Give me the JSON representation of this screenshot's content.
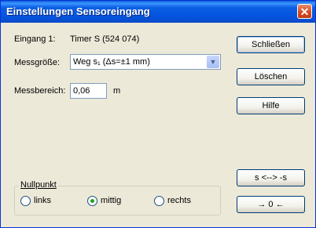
{
  "window": {
    "title": "Einstellungen Sensoreingang",
    "close_glyph": "✕"
  },
  "eingang": {
    "label": "Eingang 1:",
    "value": "Timer S (524 074)"
  },
  "messgroesse": {
    "label": "Messgröße:",
    "selected": "Weg s₁ (Δs=±1 mm)",
    "dropdown_glyph": "▼"
  },
  "messbereich": {
    "label": "Messbereich:",
    "value": "0,06",
    "unit": "m"
  },
  "buttons": {
    "schliessen": "Schließen",
    "loeschen": "Löschen",
    "hilfe": "Hilfe",
    "swap_sign": "s <--> -s",
    "zero": "→ 0 ←"
  },
  "nullpunkt": {
    "legend": "Nullpunkt",
    "options": [
      {
        "label": "links",
        "checked": false
      },
      {
        "label": "mittig",
        "checked": true
      },
      {
        "label": "rechts",
        "checked": false
      }
    ]
  }
}
